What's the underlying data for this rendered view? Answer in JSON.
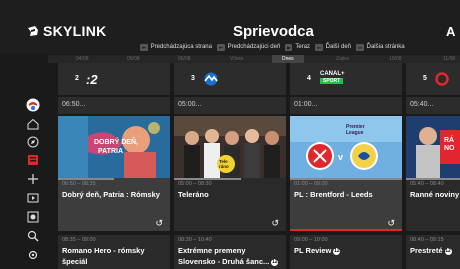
{
  "header": {
    "logo_text": "SKYLINK",
    "title": "Sprievodca",
    "title_cut": "A"
  },
  "nav": {
    "prev_day_key": "⏮",
    "prev_day": "Predchádzajúca strana",
    "prev_page_key": "⏮",
    "prev_page": "Predchádzajúci deň",
    "now_key": "▶",
    "now": "Teraz",
    "next_day_key": "⏭",
    "next_day": "Ďalší deň",
    "next_page_key": "⏭",
    "next_page": "Ďalšia stránka"
  },
  "dates": [
    {
      "label": "04/08"
    },
    {
      "label": "05/08"
    },
    {
      "label": "06/08"
    },
    {
      "label": "Včera"
    },
    {
      "label": "Dnes"
    },
    {
      "label": "Zajtra"
    },
    {
      "label": "10/08"
    },
    {
      "label": "11/08"
    }
  ],
  "sidebar": [
    {
      "icon": "profile-icon"
    },
    {
      "icon": "home-icon"
    },
    {
      "icon": "compass-icon"
    },
    {
      "icon": "guide-icon"
    },
    {
      "icon": "plus-icon"
    },
    {
      "icon": "recordings-icon"
    },
    {
      "icon": "record-icon"
    },
    {
      "icon": "search-icon"
    },
    {
      "icon": "settings-icon"
    }
  ],
  "channels": [
    {
      "number": "2",
      "logo": ":2",
      "time": "06:50...",
      "card1_time": "06:50 – 08:35",
      "card1_title": "Dobrý deň, Patria : Rómsky",
      "card1_progress": 0.5,
      "card2_time": "08:35 – 09:00",
      "card2_title": "Romano Hero - rómsky špeciál",
      "card2_badge": ""
    },
    {
      "number": "3",
      "logo": "markiza",
      "time": "05:00...",
      "card1_time": "05:00 – 08:30",
      "card1_title": "Teleráno",
      "card1_progress": 0.6,
      "card2_time": "08:30 – 10:40",
      "card2_title": "Extrémne premeny Slovensko - Druhá šanc...",
      "card2_badge": "12"
    },
    {
      "number": "4",
      "logo": "CANAL+ SPORT",
      "time": "01:00...",
      "card1_time": "01:00 – 09:00",
      "card1_title": "PL : Brentford - Leeds",
      "card1_progress": 1.0,
      "card2_time": "09:00 – 10:00",
      "card2_title": "PL Review",
      "card2_badge": "12"
    },
    {
      "number": "5",
      "logo": "JOJ",
      "time": "05:40...",
      "card1_time": "05:40 – 08:40",
      "card1_title": "Ranné noviny",
      "card1_progress": 0.7,
      "card2_time": "08:40 – 09:15",
      "card2_title": "Prestreté",
      "card2_badge": "12"
    }
  ],
  "colors": {
    "background": "#1a1a1a",
    "accent_red": "#e1262d",
    "highlight": "#3d3d3d"
  }
}
